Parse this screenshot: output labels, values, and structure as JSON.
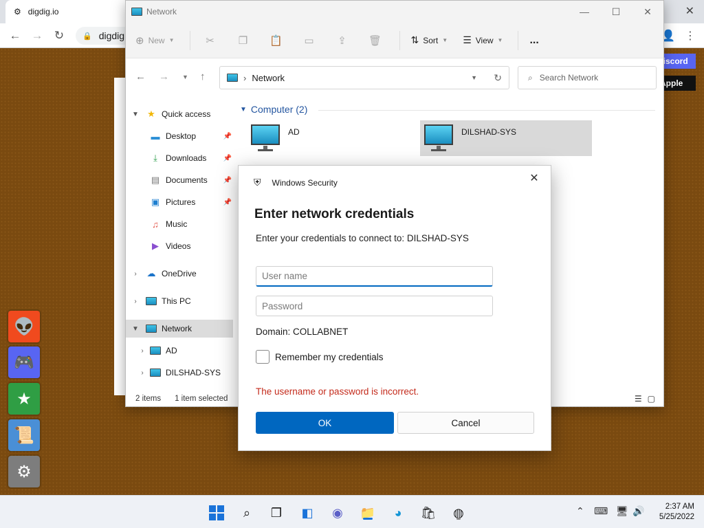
{
  "browser": {
    "tab_title": "digdig.io",
    "address": "digdig",
    "badges": {
      "discord": "Discord",
      "apple": "Apple"
    }
  },
  "explorer": {
    "title": "Network",
    "toolbar": {
      "new_label": "New",
      "sort_label": "Sort",
      "view_label": "View",
      "more_label": "..."
    },
    "address": "Network",
    "search_placeholder": "Search Network",
    "sidebar": {
      "quick_access": "Quick access",
      "desktop": "Desktop",
      "downloads": "Downloads",
      "documents": "Documents",
      "pictures": "Pictures",
      "music": "Music",
      "videos": "Videos",
      "onedrive": "OneDrive",
      "this_pc": "This PC",
      "network": "Network",
      "ad": "AD",
      "dilshad": "DILSHAD-SYS"
    },
    "group_header": "Computer (2)",
    "computers": [
      "AD",
      "DILSHAD-SYS"
    ],
    "status": {
      "items": "2 items",
      "selected": "1 item selected"
    }
  },
  "dialog": {
    "app_name": "Windows Security",
    "title": "Enter network credentials",
    "subtitle": "Enter your credentials to connect to: DILSHAD-SYS",
    "username_placeholder": "User name",
    "password_placeholder": "Password",
    "domain": "Domain: COLLABNET",
    "remember_label": "Remember my credentials",
    "error": "The username or password is incorrect.",
    "ok_label": "OK",
    "cancel_label": "Cancel",
    "error_color": "#c42b1c",
    "accent_color": "#0067c0"
  },
  "taskbar": {
    "time": "2:37 AM",
    "date": "5/25/2022"
  }
}
